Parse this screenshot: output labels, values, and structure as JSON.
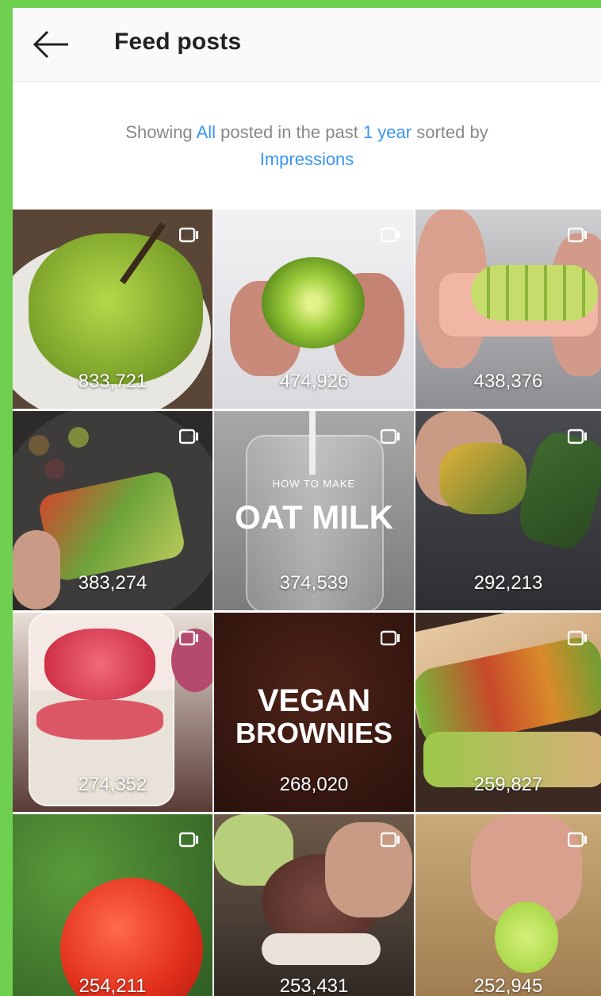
{
  "header": {
    "title": "Feed posts"
  },
  "filter": {
    "prefix": "Showing ",
    "scope": "All",
    "middle": " posted in the past ",
    "period": "1 year",
    "suffix": " sorted by",
    "sort": "Impressions"
  },
  "posts": [
    {
      "impressions": "833,721",
      "icon": "video-icon"
    },
    {
      "impressions": "474,926",
      "icon": "video-icon"
    },
    {
      "impressions": "438,376",
      "icon": "video-icon"
    },
    {
      "impressions": "383,274",
      "icon": "video-icon"
    },
    {
      "impressions": "374,539",
      "icon": "video-icon",
      "overlay_small": "HOW TO MAKE",
      "overlay_big": "OAT MILK"
    },
    {
      "impressions": "292,213",
      "icon": "video-icon"
    },
    {
      "impressions": "274,352",
      "icon": "video-icon"
    },
    {
      "impressions": "268,020",
      "icon": "video-icon",
      "overlay_big": "VEGAN",
      "overlay_big2": "BROWNIES"
    },
    {
      "impressions": "259,827",
      "icon": "video-icon"
    },
    {
      "impressions": "254,211",
      "icon": "video-icon"
    },
    {
      "impressions": "253,431",
      "icon": "video-icon"
    },
    {
      "impressions": "252,945",
      "icon": "video-icon"
    }
  ],
  "colors": {
    "background": "#6fcf4f",
    "link": "#3897f0"
  }
}
